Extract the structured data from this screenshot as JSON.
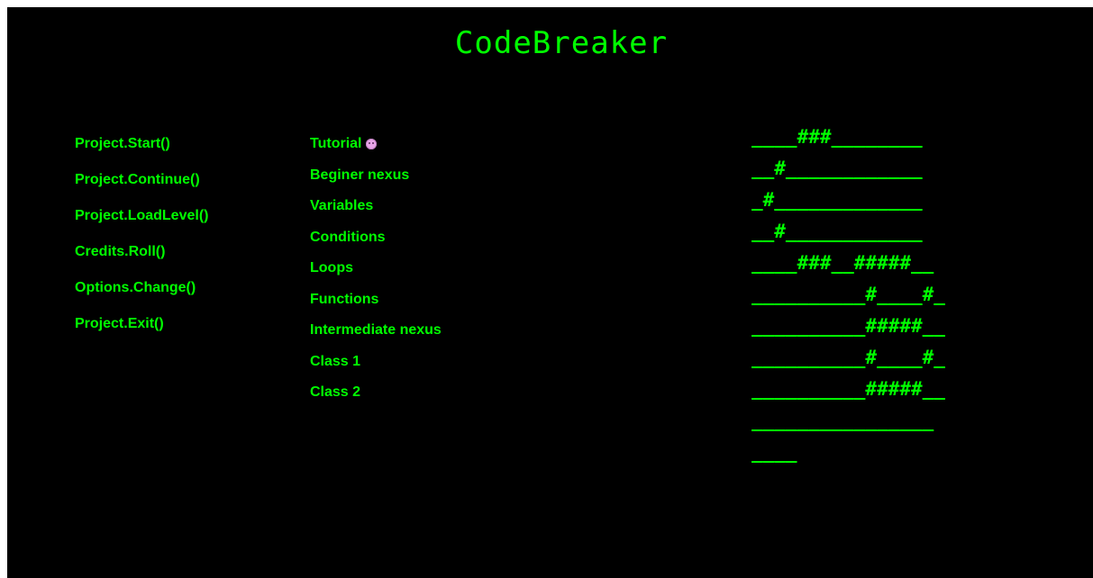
{
  "title": "CodeBreaker",
  "menu": [
    {
      "label": "Project.Start()"
    },
    {
      "label": "Project.Continue()"
    },
    {
      "label": "Project.LoadLevel()"
    },
    {
      "label": "Credits.Roll()"
    },
    {
      "label": "Options.Change()"
    },
    {
      "label": "Project.Exit()"
    }
  ],
  "levels": [
    {
      "label": "Tutorial",
      "icon": "face-icon"
    },
    {
      "label": "Beginer nexus"
    },
    {
      "label": "Variables"
    },
    {
      "label": "Conditions"
    },
    {
      "label": "Loops"
    },
    {
      "label": "Functions"
    },
    {
      "label": "Intermediate nexus"
    },
    {
      "label": "Class 1"
    },
    {
      "label": "Class 2"
    }
  ],
  "ascii_art": [
    "____###________",
    "__#____________",
    "_#_____________",
    "__#____________",
    "____###__#####__",
    "__________#____#_",
    "__________#####__",
    "__________#____#_",
    "__________#####__",
    "________________",
    "____"
  ],
  "colors": {
    "background": "#000000",
    "text": "#00ff00",
    "icon": "#e8a6e8"
  }
}
